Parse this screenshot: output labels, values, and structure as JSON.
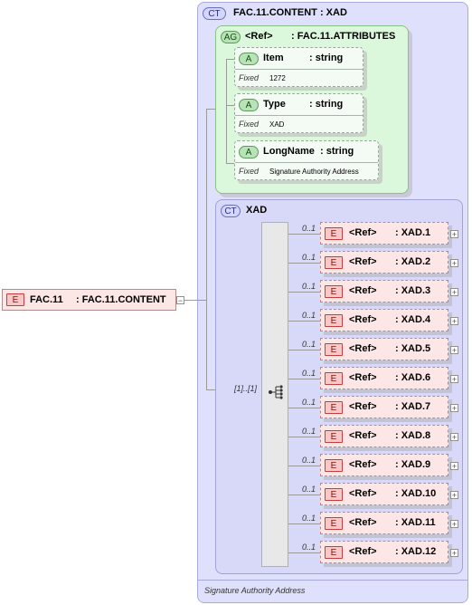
{
  "root": {
    "badge": "E",
    "name": "FAC.11",
    "type": ": FAC.11.CONTENT",
    "collapse": "−"
  },
  "complex_type": {
    "badge": "CT",
    "title": "FAC.11.CONTENT : XAD",
    "footer": "Signature Authority Address"
  },
  "attribute_group": {
    "badge": "AG",
    "ref": "<Ref>",
    "name": ": FAC.11.ATTRIBUTES"
  },
  "attributes": [
    {
      "badge": "A",
      "name": "Item",
      "type": ": string",
      "fixed_label": "Fixed",
      "fixed_value": "1272"
    },
    {
      "badge": "A",
      "name": "Type",
      "type": ": string",
      "fixed_label": "Fixed",
      "fixed_value": "XAD"
    },
    {
      "badge": "A",
      "name": "LongName",
      "type": ": string",
      "fixed_label": "Fixed",
      "fixed_value": "Signature Authority Address"
    }
  ],
  "xad": {
    "badge": "CT",
    "title": "XAD",
    "multiplicity": "[1]..[1]"
  },
  "elements": [
    {
      "badge": "E",
      "ref": "<Ref>",
      "name": ": XAD.1",
      "occ": "0..1",
      "expand": "+"
    },
    {
      "badge": "E",
      "ref": "<Ref>",
      "name": ": XAD.2",
      "occ": "0..1",
      "expand": "+"
    },
    {
      "badge": "E",
      "ref": "<Ref>",
      "name": ": XAD.3",
      "occ": "0..1",
      "expand": "+"
    },
    {
      "badge": "E",
      "ref": "<Ref>",
      "name": ": XAD.4",
      "occ": "0..1",
      "expand": "+"
    },
    {
      "badge": "E",
      "ref": "<Ref>",
      "name": ": XAD.5",
      "occ": "0..1",
      "expand": "+"
    },
    {
      "badge": "E",
      "ref": "<Ref>",
      "name": ": XAD.6",
      "occ": "0..1",
      "expand": "+"
    },
    {
      "badge": "E",
      "ref": "<Ref>",
      "name": ": XAD.7",
      "occ": "0..1",
      "expand": "+"
    },
    {
      "badge": "E",
      "ref": "<Ref>",
      "name": ": XAD.8",
      "occ": "0..1",
      "expand": "+"
    },
    {
      "badge": "E",
      "ref": "<Ref>",
      "name": ": XAD.9",
      "occ": "0..1",
      "expand": "+"
    },
    {
      "badge": "E",
      "ref": "<Ref>",
      "name": ": XAD.10",
      "occ": "0..1",
      "expand": "+"
    },
    {
      "badge": "E",
      "ref": "<Ref>",
      "name": ": XAD.11",
      "occ": "0..1",
      "expand": "+"
    },
    {
      "badge": "E",
      "ref": "<Ref>",
      "name": ": XAD.12",
      "occ": "0..1",
      "expand": "+"
    }
  ]
}
